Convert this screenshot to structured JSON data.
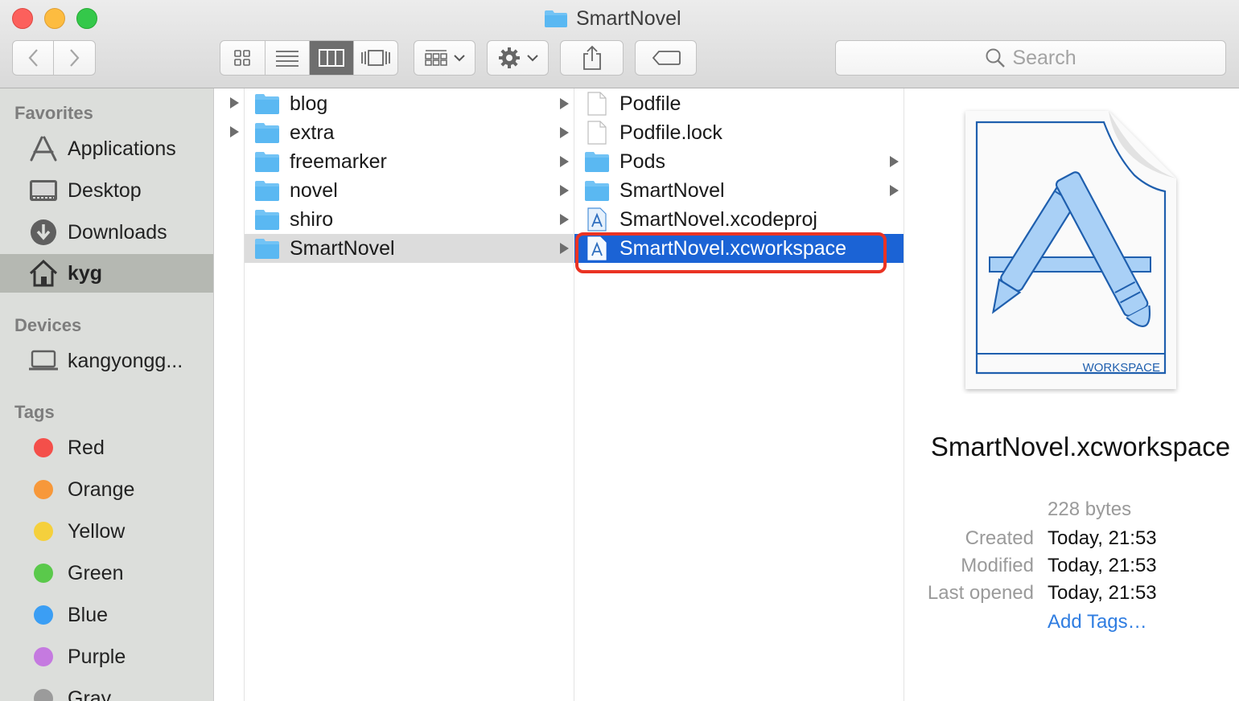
{
  "window": {
    "title": "SmartNovel"
  },
  "toolbar": {
    "search_placeholder": "Search"
  },
  "sidebar": {
    "favorites_header": "Favorites",
    "favorites": [
      {
        "label": "Applications",
        "icon": "applications-icon"
      },
      {
        "label": "Desktop",
        "icon": "desktop-icon"
      },
      {
        "label": "Downloads",
        "icon": "downloads-icon"
      },
      {
        "label": "kyg",
        "icon": "home-icon",
        "selected": true
      }
    ],
    "devices_header": "Devices",
    "devices": [
      {
        "label": "kangyongg...",
        "icon": "laptop-icon"
      }
    ],
    "tags_header": "Tags",
    "tags": [
      {
        "label": "Red",
        "color": "#f44f4a"
      },
      {
        "label": "Orange",
        "color": "#f7983a"
      },
      {
        "label": "Yellow",
        "color": "#f5d03c"
      },
      {
        "label": "Green",
        "color": "#5ac94b"
      },
      {
        "label": "Blue",
        "color": "#3b9ef4"
      },
      {
        "label": "Purple",
        "color": "#c57ae0"
      },
      {
        "label": "Gray",
        "color": "#9b9b9b"
      }
    ]
  },
  "column1": [
    {
      "name": "blog",
      "type": "folder"
    },
    {
      "name": "extra",
      "type": "folder"
    },
    {
      "name": "freemarker",
      "type": "folder"
    },
    {
      "name": "novel",
      "type": "folder"
    },
    {
      "name": "shiro",
      "type": "folder"
    },
    {
      "name": "SmartNovel",
      "type": "folder",
      "selected": true
    }
  ],
  "column2": [
    {
      "name": "Podfile",
      "type": "document"
    },
    {
      "name": "Podfile.lock",
      "type": "document"
    },
    {
      "name": "Pods",
      "type": "folder"
    },
    {
      "name": "SmartNovel",
      "type": "folder"
    },
    {
      "name": "SmartNovel.xcodeproj",
      "type": "xcode"
    },
    {
      "name": "SmartNovel.xcworkspace",
      "type": "xcode",
      "selected": true
    }
  ],
  "preview": {
    "file_name": "SmartNovel.xcworkspace",
    "icon_caption": "WORKSPACE",
    "size": "228 bytes",
    "created_label": "Created",
    "created_value": "Today, 21:53",
    "modified_label": "Modified",
    "modified_value": "Today, 21:53",
    "opened_label": "Last opened",
    "opened_value": "Today, 21:53",
    "add_tags": "Add Tags…"
  },
  "colors": {
    "selection_blue": "#1b63d5",
    "annotation_red": "#ea3323",
    "folder_blue": "#5ab8f2"
  }
}
